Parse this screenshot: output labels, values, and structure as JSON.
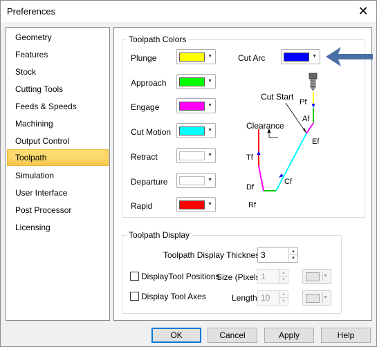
{
  "window": {
    "title": "Preferences"
  },
  "sidebar": {
    "items": [
      {
        "label": "Geometry"
      },
      {
        "label": "Features"
      },
      {
        "label": "Stock"
      },
      {
        "label": "Cutting Tools"
      },
      {
        "label": "Feeds & Speeds"
      },
      {
        "label": "Machining"
      },
      {
        "label": "Output Control"
      },
      {
        "label": "Toolpath",
        "selected": true
      },
      {
        "label": "Simulation"
      },
      {
        "label": "User Interface"
      },
      {
        "label": "Post Processor"
      },
      {
        "label": "Licensing"
      }
    ]
  },
  "toolpath_colors": {
    "legend": "Toolpath Colors",
    "rows": [
      {
        "label": "Plunge",
        "color": "#ffff00"
      },
      {
        "label": "Approach",
        "color": "#00ff00"
      },
      {
        "label": "Engage",
        "color": "#ff00ff"
      },
      {
        "label": "Cut Motion",
        "color": "#00ffff"
      },
      {
        "label": "Retract",
        "color": "#ffffff"
      },
      {
        "label": "Departure",
        "color": "#ffffff"
      },
      {
        "label": "Rapid",
        "color": "#ff0000"
      }
    ],
    "cut_arc": {
      "label": "Cut Arc",
      "color": "#0000ff"
    }
  },
  "diagram": {
    "labels": {
      "cut_start": "Cut Start",
      "clearance": "Clearance",
      "pf": "Pf",
      "af": "Af",
      "ef": "Ef",
      "cf": "Cf",
      "rf": "Rf",
      "df": "Df",
      "tf": "Tf"
    },
    "colors": {
      "plunge_arrow": "#0000ff",
      "approach": "#00cc00",
      "engage": "#ff00ff",
      "cut": "#00ffff",
      "cut_arrow": "#0000ff",
      "retract": "#00cc00",
      "departure": "#ff00ff",
      "rapid": "#ff0000",
      "tool_line": "#ffff00"
    }
  },
  "toolpath_display": {
    "legend": "Toolpath Display",
    "thickness_label": "Toolpath Display Thickness:",
    "thickness_value": "3",
    "tool_positions": {
      "label": "DisplayTool Positions",
      "checked": false,
      "size_label": "Size (Pixels)",
      "size_value": "1"
    },
    "tool_axes": {
      "label": "Display Tool Axes",
      "checked": false,
      "length_label": "Length",
      "length_value": "10"
    }
  },
  "buttons": {
    "ok": "OK",
    "cancel": "Cancel",
    "apply": "Apply",
    "help": "Help"
  },
  "accent_colors": {
    "callout_arrow": "#4a6fa5",
    "selection": "#fcdc70"
  },
  "icons": {
    "close": "close-icon",
    "dropdown": "chevron-down-icon",
    "spin_up": "spin-up-icon",
    "spin_down": "spin-down-icon",
    "tool": "drill-bit-icon"
  }
}
